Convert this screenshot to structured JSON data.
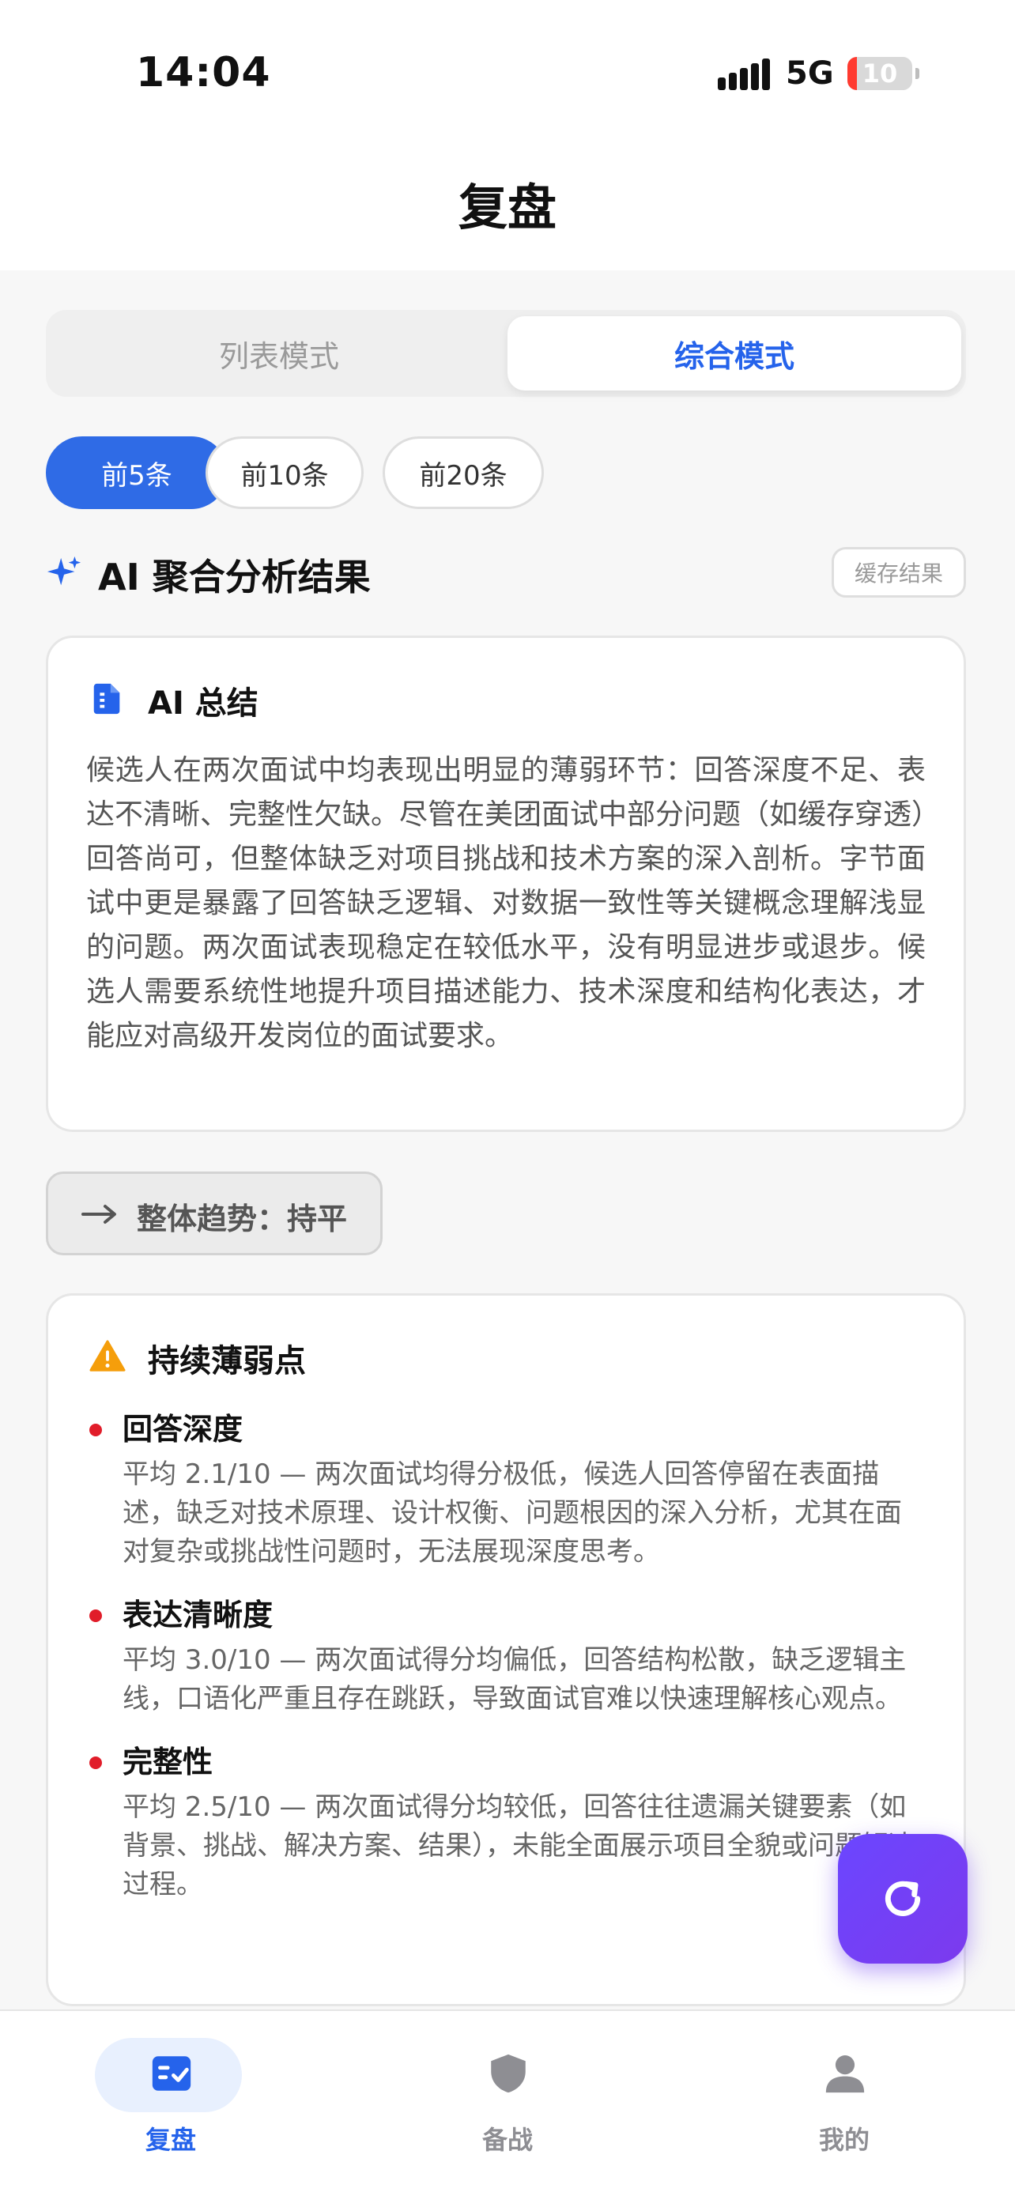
{
  "status_bar": {
    "time": "14:04",
    "network": "5G",
    "battery": "10"
  },
  "header": {
    "title": "复盘"
  },
  "mode_tabs": [
    {
      "label": "列表模式",
      "active": false
    },
    {
      "label": "综合模式",
      "active": true
    }
  ],
  "filter_chips": [
    {
      "label": "前5条",
      "active": true
    },
    {
      "label": "前10条",
      "active": false
    },
    {
      "label": "前20条",
      "active": false
    }
  ],
  "analysis": {
    "title": "AI 聚合分析结果",
    "cache_label": "缓存结果",
    "summary": {
      "icon": "document-icon",
      "title": "AI 总结",
      "text": "候选人在两次面试中均表现出明显的薄弱环节：回答深度不足、表达不清晰、完整性欠缺。尽管在美团面试中部分问题（如缓存穿透）回答尚可，但整体缺乏对项目挑战和技术方案的深入剖析。字节面试中更是暴露了回答缺乏逻辑、对数据一致性等关键概念理解浅显的问题。两次面试表现稳定在较低水平，没有明显进步或退步。候选人需要系统性地提升项目描述能力、技术深度和结构化表达，才能应对高级开发岗位的面试要求。"
    },
    "trend": {
      "label": "整体趋势：持平",
      "icon": "arrow-right-icon"
    },
    "weak_points": {
      "title": "持续薄弱点",
      "icon": "warning-icon",
      "items": [
        {
          "title": "回答深度",
          "desc": "平均 2.1/10 — 两次面试均得分极低，候选人回答停留在表面描述，缺乏对技术原理、设计权衡、问题根因的深入分析，尤其在面对复杂或挑战性问题时，无法展现深度思考。"
        },
        {
          "title": "表达清晰度",
          "desc": "平均 3.0/10 — 两次面试得分均偏低，回答结构松散，缺乏逻辑主线，口语化严重且存在跳跃，导致面试官难以快速理解核心观点。"
        },
        {
          "title": "完整性",
          "desc": "平均 2.5/10 — 两次面试得分均较低，回答往往遗漏关键要素（如背景、挑战、解决方案、结果），未能全面展示项目全貌或问题解决过程。"
        }
      ]
    }
  },
  "tab_bar": [
    {
      "label": "复盘",
      "icon": "checklist-icon",
      "active": true
    },
    {
      "label": "备战",
      "icon": "shield-icon",
      "active": false
    },
    {
      "label": "我的",
      "icon": "person-icon",
      "active": false
    }
  ],
  "colors": {
    "accent": "#2563eb",
    "fab": "#6b46ff",
    "warning": "#f59e0b",
    "bullet": "#e11d2a"
  }
}
